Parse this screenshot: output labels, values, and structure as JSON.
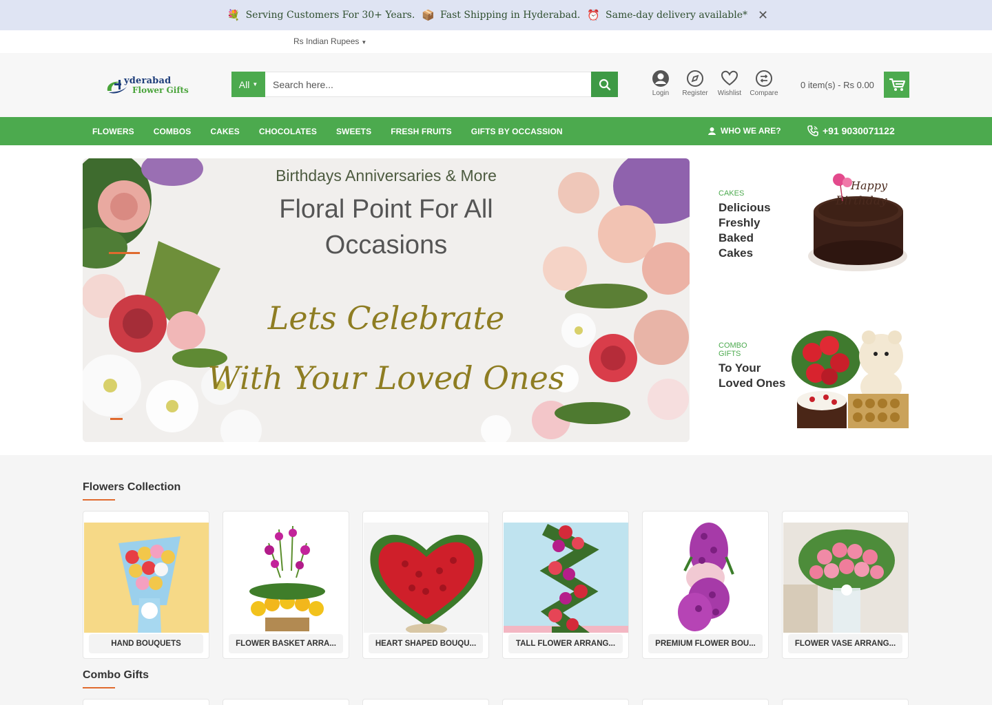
{
  "notice": {
    "item1": "Serving Customers For 30+ Years.",
    "item2": "Fast Shipping in Hyderabad.",
    "item3": "Same-day delivery available*",
    "close": "✕"
  },
  "currency": {
    "label": "Rs Indian Rupees"
  },
  "logo": {
    "line1": "yderabad",
    "line2": "Flower Gifts"
  },
  "search": {
    "category": "All",
    "placeholder": "Search here..."
  },
  "header_icons": [
    {
      "label": "Login",
      "icon": "user-icon"
    },
    {
      "label": "Register",
      "icon": "compass-icon"
    },
    {
      "label": "Wishlist",
      "icon": "heart-icon"
    },
    {
      "label": "Compare",
      "icon": "compare-icon"
    }
  ],
  "cart": {
    "summary": "0 item(s) - Rs 0.00"
  },
  "nav": {
    "items": [
      "FLOWERS",
      "COMBOS",
      "CAKES",
      "CHOCOLATES",
      "SWEETS",
      "FRESH FRUITS",
      "GIFTS BY OCCASSION"
    ],
    "who": "WHO WE ARE?",
    "phone": "+91 9030071122"
  },
  "slider": {
    "line1": "Birthdays Anniversaries & More",
    "line2": "Floral Point For All",
    "line3": "Occasions",
    "line4": "Lets Celebrate",
    "line5": "With Your Loved Ones"
  },
  "promos": [
    {
      "kicker": "CAKES",
      "title": "Delicious Freshly Baked Cakes"
    },
    {
      "kicker": "COMBO GIFTS",
      "title": "To Your Loved Ones"
    }
  ],
  "flowers_collection": {
    "title": "Flowers Collection",
    "items": [
      "HAND BOUQUETS",
      "FLOWER BASKET ARRA...",
      "HEART SHAPED BOUQU...",
      "TALL FLOWER ARRANG...",
      "PREMIUM FLOWER BOU...",
      "FLOWER VASE ARRANG..."
    ]
  },
  "combo_gifts": {
    "title": "Combo Gifts"
  },
  "colors": {
    "brand_green": "#4caa4e",
    "accent_orange": "#e06a2e",
    "notice_bg": "#dfe4f3"
  }
}
